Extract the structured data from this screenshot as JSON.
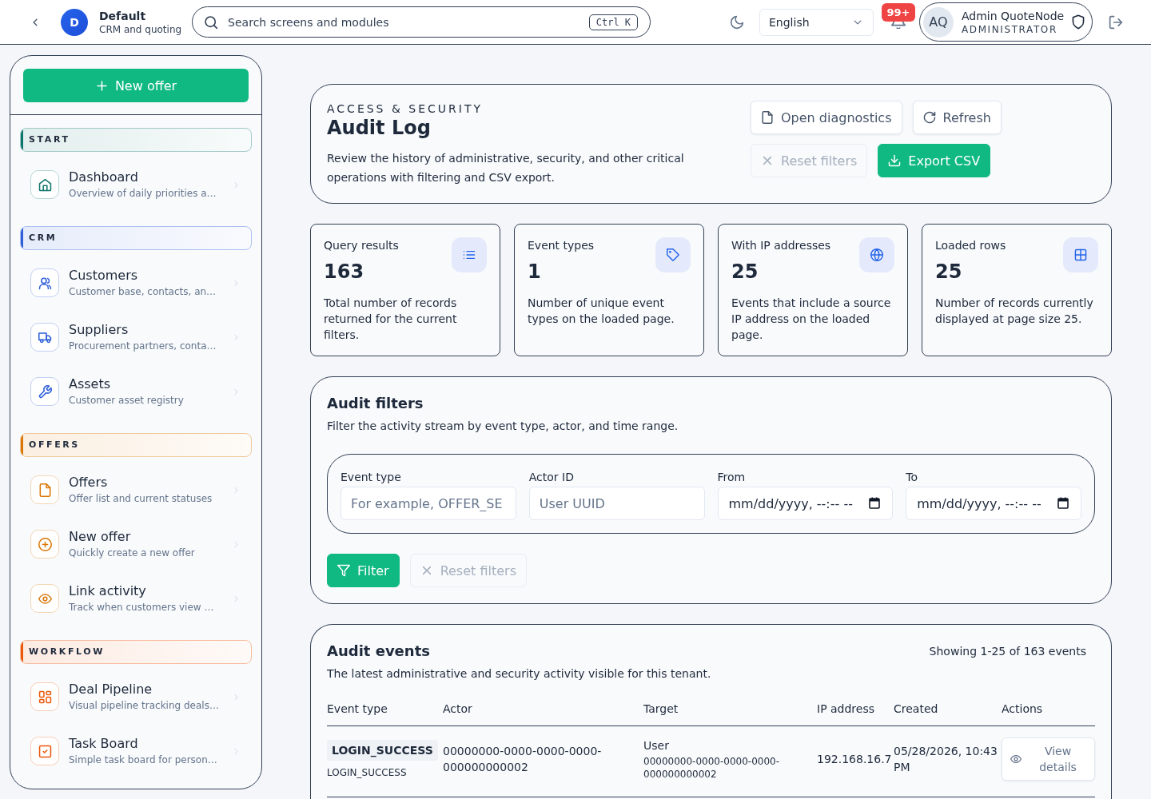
{
  "topbar": {
    "brand": {
      "initial": "D",
      "name": "Default",
      "subtitle": "CRM and quoting"
    },
    "search": {
      "placeholder": "Search screens and modules",
      "shortcut": "Ctrl K"
    },
    "language": {
      "value": "English"
    },
    "notifications": {
      "badge": "99+"
    },
    "user": {
      "initials": "AQ",
      "name": "Admin QuoteNode",
      "role": "ADMINISTRATOR"
    }
  },
  "sidebar": {
    "primary_action": {
      "label": "New offer"
    },
    "sections": [
      {
        "title": "START",
        "color": "#0f766e",
        "items": [
          {
            "title": "Dashboard",
            "description": "Overview of daily priorities a…"
          }
        ]
      },
      {
        "title": "CRM",
        "color": "#2f5fd8",
        "items": [
          {
            "title": "Customers",
            "description": "Customer base, contacts, an…"
          },
          {
            "title": "Suppliers",
            "description": "Procurement partners, conta…"
          },
          {
            "title": "Assets",
            "description": "Customer asset registry"
          }
        ]
      },
      {
        "title": "OFFERS",
        "color": "#d97706",
        "items": [
          {
            "title": "Offers",
            "description": "Offer list and current statuses"
          },
          {
            "title": "New offer",
            "description": "Quickly create a new offer"
          },
          {
            "title": "Link activity",
            "description": "Track when customers view …"
          }
        ]
      },
      {
        "title": "WORKFLOW",
        "color": "#ea580c",
        "items": [
          {
            "title": "Deal Pipeline",
            "description": "Visual pipeline tracking deals…"
          },
          {
            "title": "Task Board",
            "description": "Simple task board for person…"
          }
        ]
      }
    ]
  },
  "page_header": {
    "eyebrow": "ACCESS & SECURITY",
    "title": "Audit Log",
    "description": "Review the history of administrative, security, and other critical operations with filtering and CSV export.",
    "actions": [
      {
        "label": "Open diagnostics",
        "kind": "secondary",
        "disabled": false
      },
      {
        "label": "Refresh",
        "kind": "secondary",
        "disabled": false
      },
      {
        "label": "Reset filters",
        "kind": "secondary",
        "disabled": true
      },
      {
        "label": "Export CSV",
        "kind": "primary",
        "disabled": false
      }
    ]
  },
  "stats": [
    {
      "label": "Query results",
      "value": "163",
      "description": "Total number of records returned for the current filters."
    },
    {
      "label": "Event types",
      "value": "1",
      "description": "Number of unique event types on the loaded page."
    },
    {
      "label": "With IP addresses",
      "value": "25",
      "description": "Events that include a source IP address on the loaded page."
    },
    {
      "label": "Loaded rows",
      "value": "25",
      "description": "Number of records currently displayed at page size 25."
    }
  ],
  "filters": {
    "title": "Audit filters",
    "description": "Filter the activity stream by event type, actor, and time range.",
    "fields": [
      {
        "label": "Event type",
        "kind": "text",
        "placeholder": "For example, OFFER_SE"
      },
      {
        "label": "Actor ID",
        "kind": "text",
        "placeholder": "User UUID"
      },
      {
        "label": "From",
        "kind": "datetime",
        "placeholder": "mm/dd/yyyy, --:-- --"
      },
      {
        "label": "To",
        "kind": "datetime",
        "placeholder": "mm/dd/yyyy, --:-- --"
      }
    ],
    "actions": [
      {
        "label": "Filter",
        "kind": "primary",
        "disabled": false
      },
      {
        "label": "Reset filters",
        "kind": "secondary",
        "disabled": true
      }
    ]
  },
  "events": {
    "title": "Audit events",
    "summary": "Showing 1-25 of 163 events",
    "description": "The latest administrative and security activity visible for this tenant.",
    "columns": [
      "Event type",
      "Actor",
      "Target",
      "IP address",
      "Created",
      "Actions"
    ],
    "rows": [
      {
        "event_type": "LOGIN_SUCCESS",
        "event_code": "LOGIN_SUCCESS",
        "actor": "00000000-0000-0000-0000-000000000002",
        "target_type": "User",
        "target_id": "00000000-0000-0000-0000-000000000002",
        "ip_address": "192.168.16.7",
        "created": "05/28/2026, 10:43 PM",
        "action": "View details"
      }
    ]
  }
}
